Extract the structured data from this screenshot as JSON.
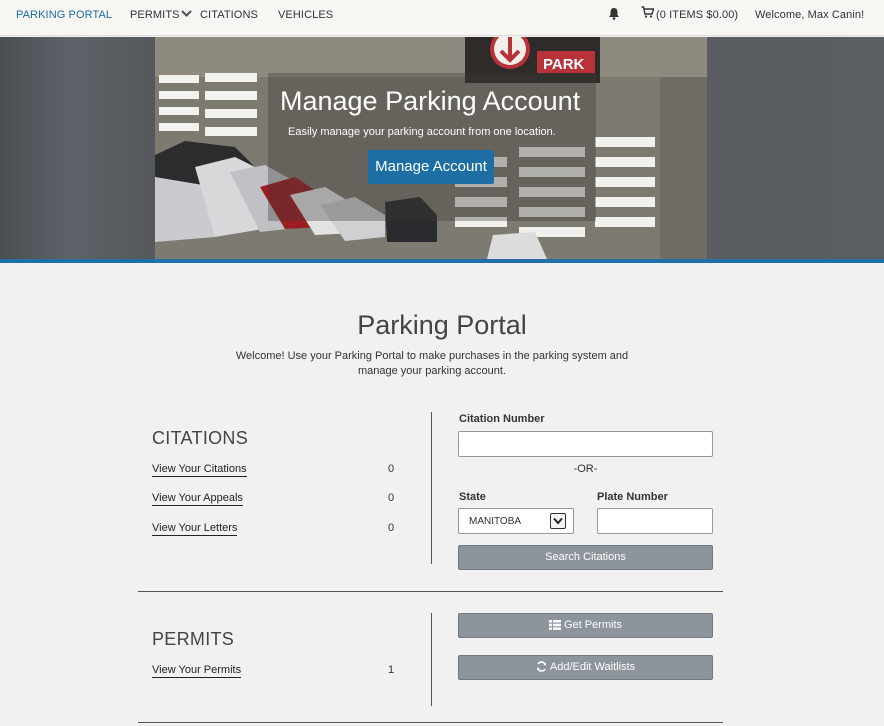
{
  "nav": {
    "brand": "PARKING PORTAL",
    "permits": "PERMITS",
    "citations": "CITATIONS",
    "vehicles": "VEHICLES",
    "cart": "(0 ITEMS $0.00)",
    "welcome": "Welcome, Max Canin!"
  },
  "hero": {
    "sign": "PARK",
    "title": "Manage Parking Account",
    "subtitle": "Easily manage your parking account from one location.",
    "button": "Manage Account"
  },
  "page": {
    "title": "Parking Portal",
    "intro": "Welcome! Use your Parking Portal to make purchases in the parking system and manage your parking account."
  },
  "citations": {
    "heading": "CITATIONS",
    "rows": [
      {
        "label": "View Your Citations",
        "count": "0"
      },
      {
        "label": "View Your Appeals",
        "count": "0"
      },
      {
        "label": "View Your Letters",
        "count": "0"
      }
    ],
    "citation_number_label": "Citation Number",
    "or_text": "-OR-",
    "state_label": "State",
    "state_value": "MANITOBA",
    "plate_label": "Plate Number",
    "search_button": "Search Citations"
  },
  "permits": {
    "heading": "PERMITS",
    "rows": [
      {
        "label": "View Your Permits",
        "count": "1"
      }
    ],
    "get_button": "Get Permits",
    "waitlist_button": "Add/Edit Waitlists"
  },
  "colors": {
    "accent": "#1c6ea4",
    "button_grey": "#8e949c",
    "background": "#f1f1f1"
  }
}
